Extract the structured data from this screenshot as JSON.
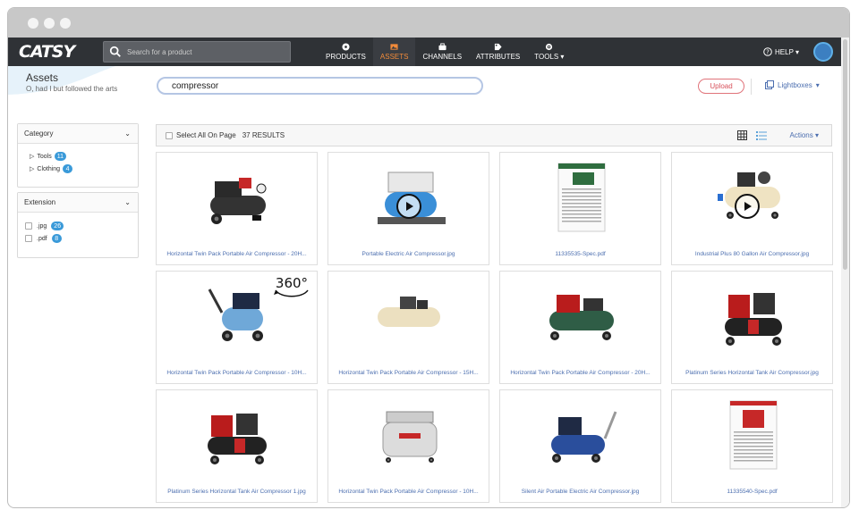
{
  "app": {
    "logo": "CATSY"
  },
  "nav": {
    "search_placeholder": "Search for a product",
    "items": [
      {
        "label": "PRODUCTS",
        "icon": "products-icon"
      },
      {
        "label": "ASSETS",
        "icon": "assets-icon",
        "active": true
      },
      {
        "label": "CHANNELS",
        "icon": "channels-icon"
      },
      {
        "label": "ATTRIBUTES",
        "icon": "attributes-icon"
      },
      {
        "label": "TOOLS ▾",
        "icon": "tools-icon"
      }
    ],
    "help": "HELP ▾"
  },
  "page": {
    "title": "Assets",
    "subtitle": "O, had I but followed the arts",
    "search_value": "compressor",
    "upload": "Upload",
    "lightboxes": "Lightboxes"
  },
  "filters": {
    "category": {
      "title": "Category",
      "items": [
        {
          "label": "Tools",
          "count": "11"
        },
        {
          "label": "Clothing",
          "count": "4"
        }
      ]
    },
    "extension": {
      "title": "Extension",
      "items": [
        {
          "label": ".jpg",
          "count": "26"
        },
        {
          "label": ".pdf",
          "count": "8"
        }
      ]
    }
  },
  "toolbar": {
    "select_all": "Select All On Page",
    "results": "37 RESULTS",
    "actions": "Actions"
  },
  "assets": [
    {
      "name": "Horizontal Twin Pack Portable Air Compressor - 20H...",
      "kind": "red-twin"
    },
    {
      "name": "Portable Electric Air Compressor.jpg",
      "kind": "blue-video"
    },
    {
      "name": "11335535-Spec.pdf",
      "kind": "pdf-green"
    },
    {
      "name": "Industrial Plus 80 Gallon Air Compressor.jpg",
      "kind": "cream-video"
    },
    {
      "name": "Horizontal Twin Pack Portable Air Compressor - 10H...",
      "kind": "blue-360"
    },
    {
      "name": "Horizontal Twin Pack Portable Air Compressor - 15H...",
      "kind": "cream-small"
    },
    {
      "name": "Horizontal Twin Pack Portable Air Compressor - 20H...",
      "kind": "green-engine"
    },
    {
      "name": "Platinum Series Horizontal Tank Air Compressor.jpg",
      "kind": "red-engine"
    },
    {
      "name": "Platinum Series Horizontal Tank Air Compressor 1.jpg",
      "kind": "red-engine2"
    },
    {
      "name": "Horizontal Twin Pack Portable Air Compressor - 10H...",
      "kind": "silver-pancake"
    },
    {
      "name": "Silent Air Portable Electric Air Compressor.jpg",
      "kind": "blue-tank"
    },
    {
      "name": "11335540-Spec.pdf",
      "kind": "pdf-red"
    }
  ]
}
